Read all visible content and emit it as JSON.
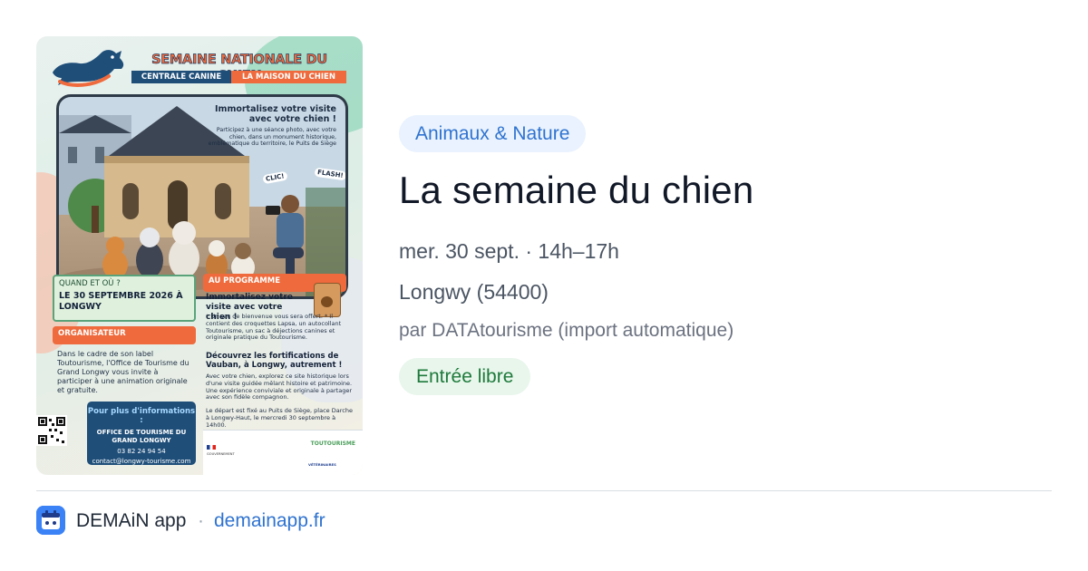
{
  "poster": {
    "title": "SEMAINE NATIONALE DU CHIEN",
    "sub_left": "CENTRALE CANINE",
    "sub_right": "LA MAISON DU CHIEN",
    "scene_heading": "Immortalisez votre visite avec votre chien !",
    "scene_text": "Participez à une séance photo, avec votre chien, dans un monument historique, emblématique du territoire, le Puits de Siège",
    "clic": "CLIC!",
    "flash": "FLASH!",
    "when_label": "QUAND ET OÙ ?",
    "when_value": "LE 30 SEPTEMBRE 2026 À LONGWY",
    "orga_label": "ORGANISATEUR",
    "orga_text": "Dans le cadre de son label Toutourisme, l'Office de Tourisme du Grand Longwy vous invite à participer à une animation originale et gratuite.",
    "prog_label": "AU PROGRAMME",
    "prog_title": "Immortalisez votre visite avec votre chien !",
    "prog_list": "* Un sac de bienvenue vous sera offert. * Il contient des croquettes Lapsa, un autocollant Toutourisme, un sac à déjections canines et originale pratique du Toutourisme.",
    "prog_title2": "Découvrez les fortifications de Vauban, à Longwy, autrement !",
    "prog_text2": "Avec votre chien, explorez ce site historique lors d'une visite guidée mêlant histoire et patrimoine. Une expérience conviviale et originale à partager avec son fidèle compagnon.",
    "prog_text3": "Le départ est fixé au Puits de Siège, place Darche à Longwy-Haut, le mercredi 30 septembre à 14h00.",
    "info_label": "Pour plus d'informations :",
    "info_org": "OFFICE DE TOURISME DU GRAND LONGWY",
    "info_phone": "03 82 24 94 54",
    "info_email": "contact@longwy-tourisme.com",
    "sponsor_gov": "GOUVERNEMENT",
    "sponsor_vet": "VÉTÉRINAIRES",
    "sponsor_tour": "TOUTOURISME"
  },
  "event": {
    "category": "Animaux & Nature",
    "title": "La semaine du chien",
    "date": "mer. 30 sept. · 14h–17h",
    "place": "Longwy (54400)",
    "source": "par DATAtourisme (import automatique)",
    "price": "Entrée libre"
  },
  "footer": {
    "app_name": "DEMAiN app",
    "separator": "·",
    "link": "demainapp.fr"
  },
  "colors": {
    "category_bg": "#e9f2fe",
    "category_fg": "#2f73d0",
    "price_bg": "#e8f6ec",
    "price_fg": "#1e7a3b",
    "link": "#2f73d0",
    "poster_orange": "#ef6a3c",
    "poster_navy": "#1f4e79"
  },
  "icons": {
    "app": "app-logo-icon",
    "dog": "dog-logo-icon",
    "qr": "qr-code-icon"
  }
}
